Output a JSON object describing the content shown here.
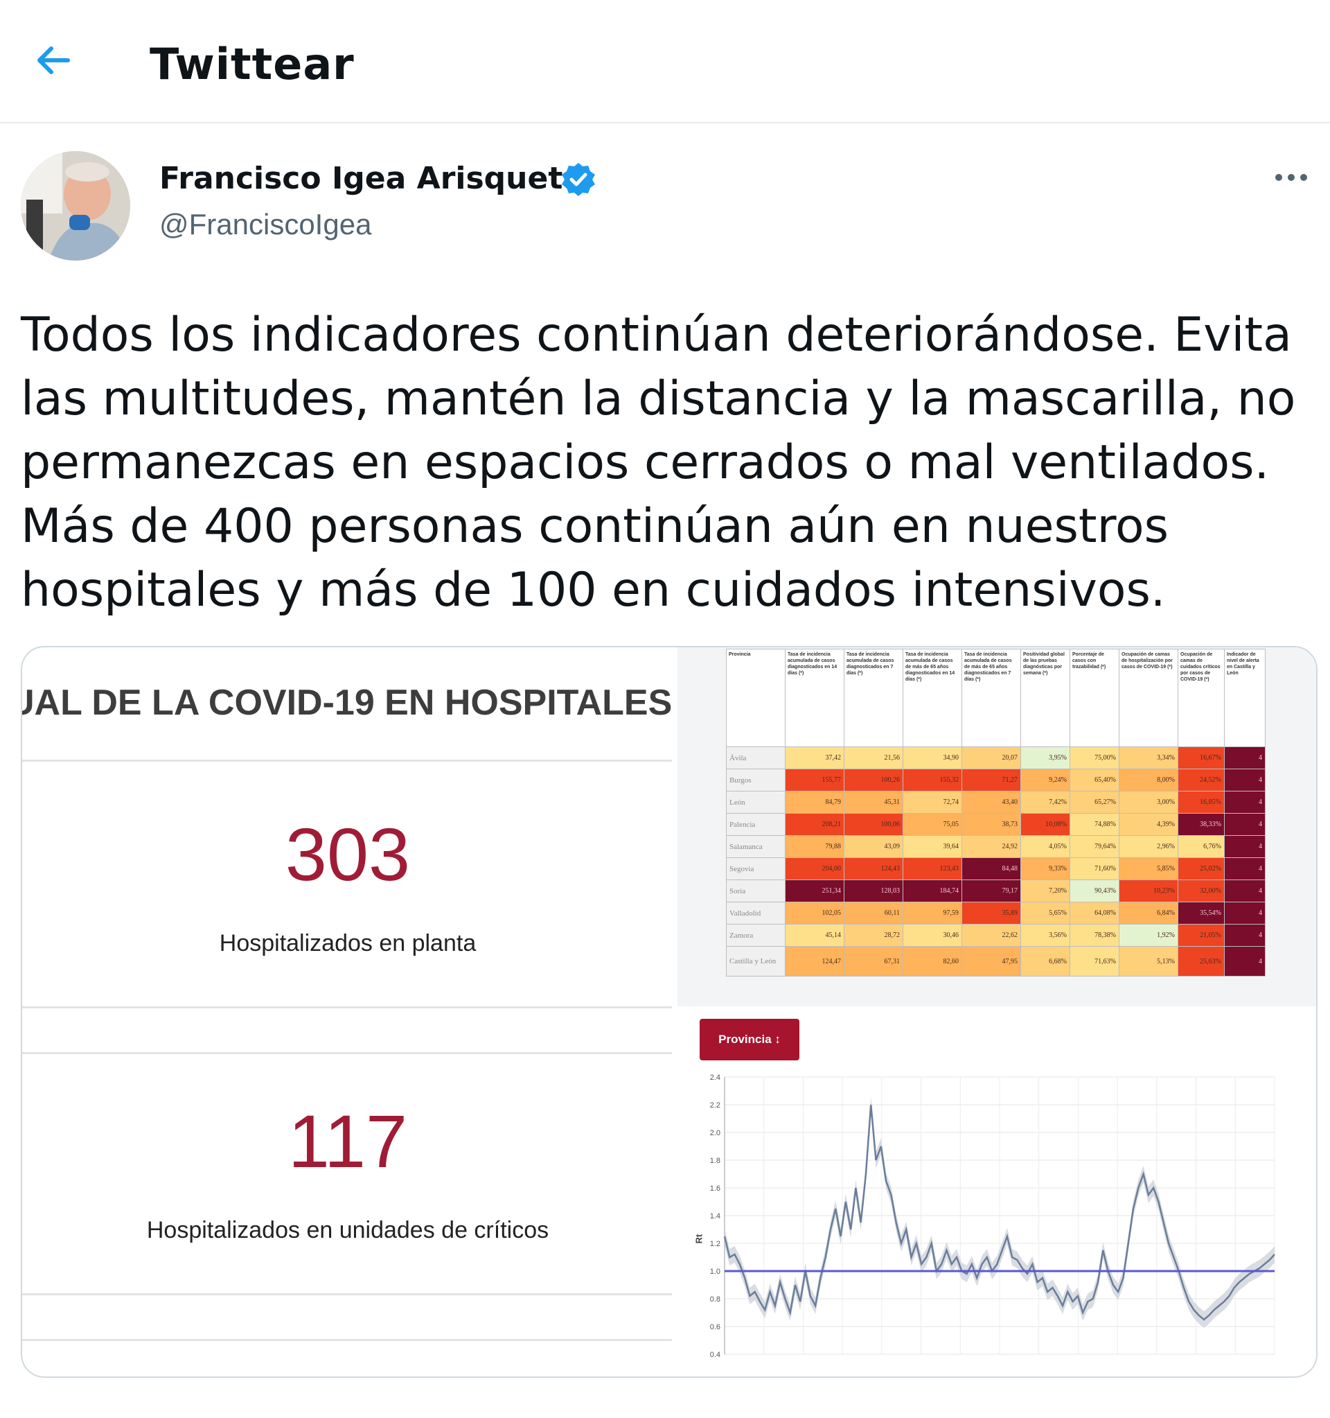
{
  "header": {
    "title": "Twittear",
    "back_icon": "arrow-left-icon"
  },
  "author": {
    "name": "Francisco Igea Arisqueta",
    "handle": "@FranciscoIgea",
    "verified_icon": "verified-badge-icon",
    "more_icon": "more-options-icon"
  },
  "tweet": {
    "text": "Todos los indicadores continúan deteriorándose. Evita las multitudes, mantén la distancia y la mascarilla, no permanezcas en espacios cerrados o mal ventilados. Más de 400 personas continúan aún en nuestros hospitales y más de 100 en cuidados intensivos."
  },
  "media": {
    "hospitals": {
      "title": "UAL DE LA COVID-19 EN HOSPITALES",
      "ward_value": "303",
      "ward_label": "Hospitalizados en planta",
      "icu_value": "117",
      "icu_label": "Hospitalizados en unidades de críticos"
    },
    "table": {
      "headers": [
        "Provincia",
        "Tasa de incidencia acumulada de casos diagnosticados en 14 días (*)",
        "Tasa de incidencia acumulada de casos diagnosticados en 7 días (*)",
        "Tasa de incidencia acumulada de casos de más de 65 años diagnosticados en 14 días (*)",
        "Tasa de incidencia acumulada de casos de más de 65 años diagnosticados en 7 días (*)",
        "Positividad global de las pruebas diagnósticas por semana (*)",
        "Porcentaje de casos con trazabilidad (*)",
        "Ocupación de camas de hospitalización por casos de COVID-19 (*)",
        "Ocupación de camas de cuidados críticos por casos de COVID-19 (*)",
        "Indicador de nivel de alerta en Castilla y León"
      ],
      "rows": [
        {
          "name": "Ávila",
          "cells": [
            "37,42",
            "21,56",
            "34,90",
            "20,07",
            "3,95%",
            "75,00%",
            "3,34%",
            "16,67%",
            "4"
          ]
        },
        {
          "name": "Burgos",
          "cells": [
            "155,77",
            "100,26",
            "155,32",
            "71,27",
            "9,24%",
            "65,40%",
            "8,00%",
            "24,52%",
            "4"
          ]
        },
        {
          "name": "León",
          "cells": [
            "84,79",
            "45,31",
            "72,74",
            "43,40",
            "7,42%",
            "65,27%",
            "3,00%",
            "16,85%",
            "4"
          ]
        },
        {
          "name": "Palencia",
          "cells": [
            "208,21",
            "100,06",
            "75,05",
            "38,73",
            "10,08%",
            "74,88%",
            "4,39%",
            "38,33%",
            "4"
          ]
        },
        {
          "name": "Salamanca",
          "cells": [
            "79,88",
            "43,09",
            "39,64",
            "24,92",
            "4,05%",
            "79,64%",
            "2,96%",
            "6,76%",
            "4"
          ]
        },
        {
          "name": "Segovia",
          "cells": [
            "204,00",
            "124,43",
            "123,43",
            "84,48",
            "9,33%",
            "71,60%",
            "5,85%",
            "25,02%",
            "4"
          ]
        },
        {
          "name": "Soria",
          "cells": [
            "251,34",
            "128,03",
            "184,74",
            "79,17",
            "7,20%",
            "90,43%",
            "10,23%",
            "32,00%",
            "4"
          ]
        },
        {
          "name": "Valladolid",
          "cells": [
            "102,05",
            "60,11",
            "97,59",
            "35,89",
            "5,65%",
            "64,08%",
            "6,84%",
            "35,54%",
            "4"
          ]
        },
        {
          "name": "Zamora",
          "cells": [
            "45,14",
            "28,72",
            "30,46",
            "22,62",
            "3,56%",
            "78,38%",
            "1,92%",
            "21,05%",
            "4"
          ]
        },
        {
          "name": "Castilla y León",
          "cells": [
            "124,47",
            "67,31",
            "82,60",
            "47,95",
            "6,68%",
            "71,63%",
            "5,13%",
            "25,63%",
            "4"
          ]
        }
      ],
      "colors": [
        [
          "#ffe08a",
          "#ffe08a",
          "#ffe08a",
          "#ffd07a",
          "#e4f3cf",
          "#ffe08a",
          "#ffd07a",
          "#ee4422",
          "#7a0c2c"
        ],
        [
          "#ee4422",
          "#ee4422",
          "#ee4422",
          "#ee4422",
          "#ffb35a",
          "#ffd07a",
          "#ffb35a",
          "#ee4422",
          "#7a0c2c"
        ],
        [
          "#ffb35a",
          "#ffb35a",
          "#ffd07a",
          "#ffb35a",
          "#ffd07a",
          "#ffd07a",
          "#ffd07a",
          "#ee4422",
          "#7a0c2c"
        ],
        [
          "#ee4422",
          "#ee4422",
          "#ffb35a",
          "#ffb35a",
          "#ee4422",
          "#ffe08a",
          "#ffd07a",
          "#7a0c2c",
          "#7a0c2c"
        ],
        [
          "#ffb35a",
          "#ffd07a",
          "#ffe08a",
          "#ffd07a",
          "#ffe08a",
          "#ffe08a",
          "#ffe08a",
          "#ffe08a",
          "#7a0c2c"
        ],
        [
          "#ee4422",
          "#ee4422",
          "#ee4422",
          "#7a0c2c",
          "#ffb35a",
          "#ffe08a",
          "#ffb35a",
          "#ee4422",
          "#7a0c2c"
        ],
        [
          "#7a0c2c",
          "#7a0c2c",
          "#7a0c2c",
          "#7a0c2c",
          "#ffd07a",
          "#e4f3cf",
          "#ee4422",
          "#ee4422",
          "#7a0c2c"
        ],
        [
          "#ffb35a",
          "#ffb35a",
          "#ffb35a",
          "#ee4422",
          "#ffd07a",
          "#ffd07a",
          "#ffb35a",
          "#7a0c2c",
          "#7a0c2c"
        ],
        [
          "#ffe08a",
          "#ffd07a",
          "#ffe08a",
          "#ffd07a",
          "#ffe08a",
          "#ffe08a",
          "#e4f3cf",
          "#ee4422",
          "#7a0c2c"
        ],
        [
          "#ffb35a",
          "#ffb35a",
          "#ffb35a",
          "#ffb35a",
          "#ffd07a",
          "#ffe08a",
          "#ffd07a",
          "#ee4422",
          "#7a0c2c"
        ]
      ]
    },
    "province_button": "Provincia ↕",
    "chart_data": {
      "type": "line",
      "ylabel": "Rt",
      "ylim": [
        0.4,
        2.4
      ],
      "yticks": [
        "0.4",
        "0.6",
        "0.8",
        "1.0",
        "1.2",
        "1.4",
        "1.6",
        "1.8",
        "2.0",
        "2.2",
        "2.4"
      ],
      "threshold": 1.0,
      "line_color": "#6a7d99",
      "threshold_color": "#5b57d6",
      "series": [
        {
          "values": [
            1.25,
            1.1,
            1.12,
            1.05,
            0.95,
            0.82,
            0.85,
            0.78,
            0.72,
            0.85,
            0.75,
            0.92,
            0.8,
            0.7,
            0.9,
            0.78,
            1.0,
            0.82,
            0.75,
            0.95,
            1.1,
            1.3,
            1.45,
            1.25,
            1.5,
            1.3,
            1.6,
            1.35,
            1.7,
            2.2,
            1.8,
            1.9,
            1.65,
            1.55,
            1.35,
            1.2,
            1.3,
            1.1,
            1.2,
            1.05,
            1.1,
            1.2,
            1.0,
            1.05,
            1.15,
            1.05,
            1.1,
            1.0,
            0.98,
            1.05,
            0.95,
            1.05,
            1.1,
            1.0,
            1.05,
            1.15,
            1.25,
            1.1,
            1.08,
            1.02,
            0.98,
            1.05,
            0.92,
            0.95,
            0.85,
            0.88,
            0.82,
            0.75,
            0.85,
            0.78,
            0.82,
            0.7,
            0.78,
            0.8,
            0.92,
            1.15,
            1.0,
            0.9,
            0.85,
            0.95,
            1.2,
            1.45,
            1.6,
            1.7,
            1.55,
            1.6,
            1.5,
            1.35,
            1.2,
            1.1,
            1.0,
            0.88,
            0.78,
            0.72,
            0.68,
            0.65,
            0.68,
            0.72,
            0.75,
            0.78,
            0.82,
            0.88,
            0.92,
            0.95,
            0.98,
            1.0,
            1.02,
            1.05,
            1.08,
            1.12
          ]
        }
      ]
    }
  }
}
